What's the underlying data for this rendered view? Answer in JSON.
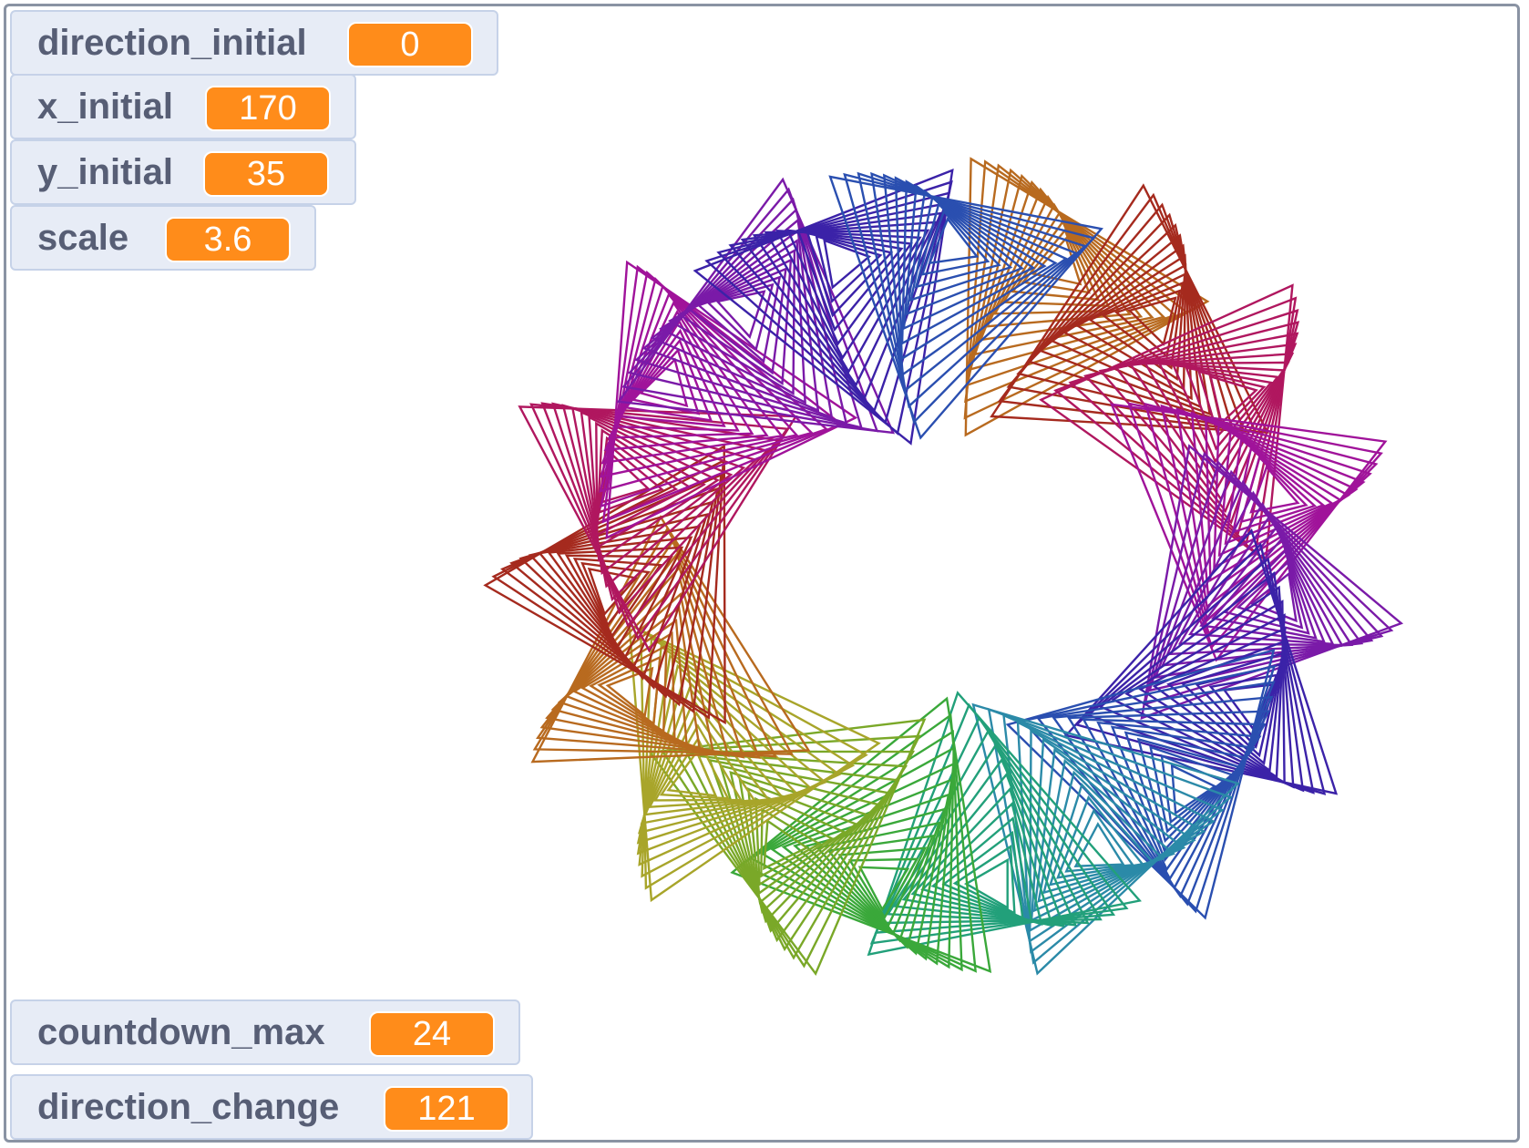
{
  "monitors": {
    "direction_initial": {
      "label": "direction_initial",
      "value": "0"
    },
    "x_initial": {
      "label": "x_initial",
      "value": "170"
    },
    "y_initial": {
      "label": "y_initial",
      "value": "35"
    },
    "scale": {
      "label": "scale",
      "value": "3.6"
    },
    "countdown_max": {
      "label": "countdown_max",
      "value": "24"
    },
    "direction_change": {
      "label": "direction_change",
      "value": "121"
    }
  },
  "colors": {
    "monitor_value_bg": "#ff8c1a",
    "monitor_bg": "#e7ecf6",
    "monitor_text": "#575e75",
    "stage_border": "#8a93a3"
  },
  "drawing": {
    "pattern": "ring of nested triangle spirals",
    "spiral_count": 19,
    "color_cycle": [
      "#b86a1f",
      "#a52a1e",
      "#b0175f",
      "#a0139a",
      "#7a1aa8",
      "#3b22a8",
      "#2a4fb0",
      "#2b8aa8",
      "#22a07a",
      "#3aa83a",
      "#7aa828",
      "#a8a52a"
    ]
  }
}
